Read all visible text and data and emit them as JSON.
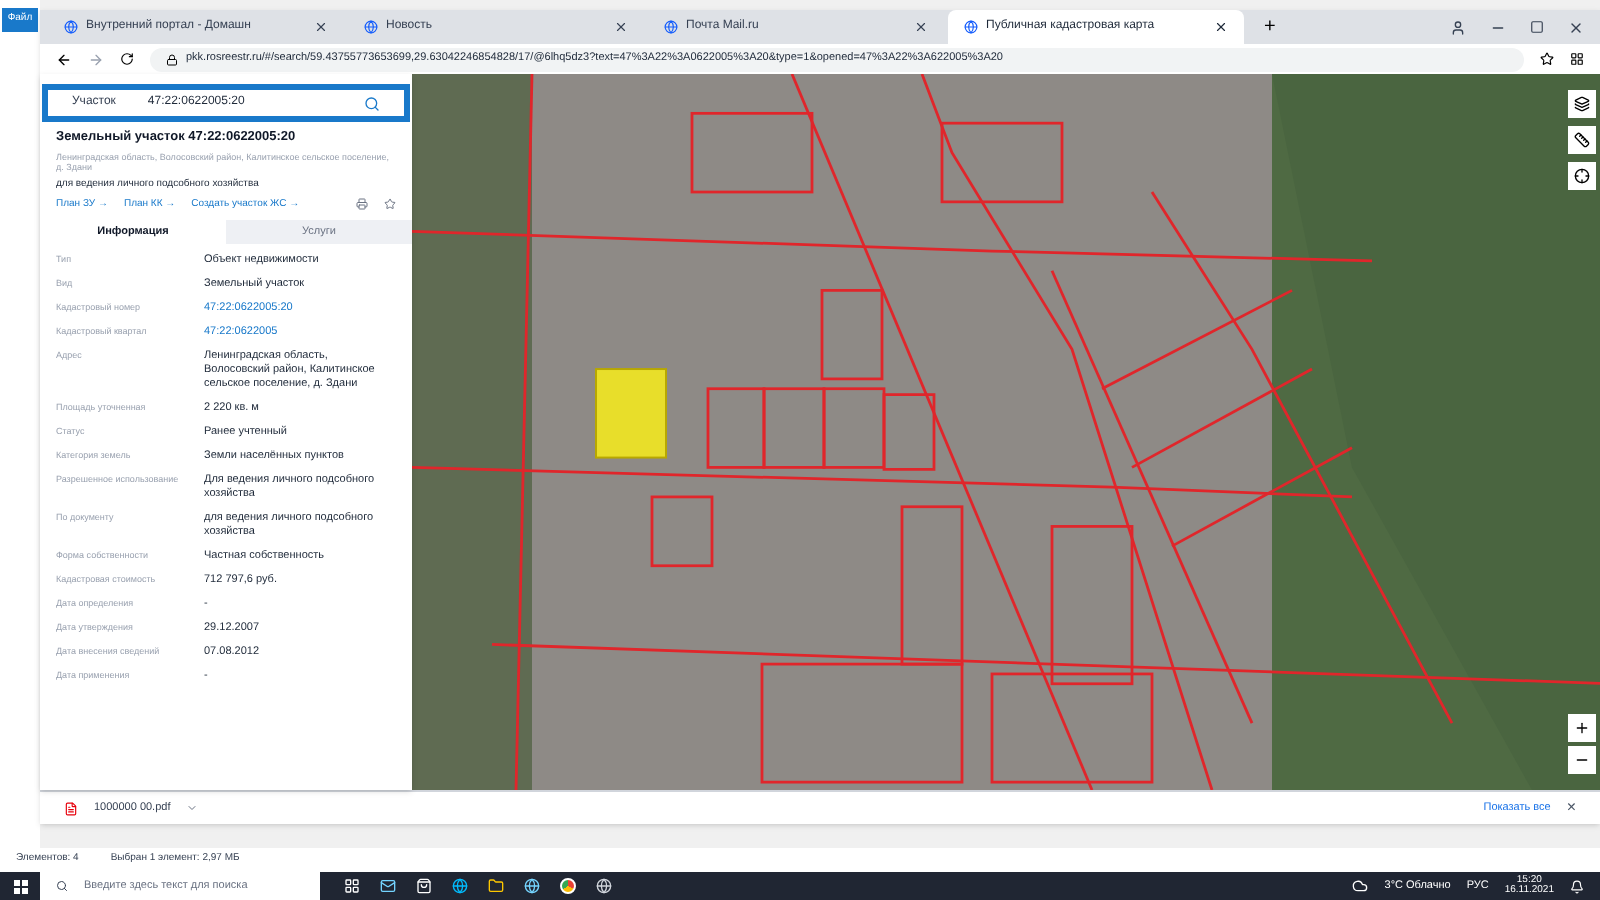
{
  "desktop": {
    "ribbon_button": "Файл"
  },
  "browser": {
    "tabs": [
      {
        "label": "Внутренний портал - Домашн",
        "selected": false
      },
      {
        "label": "Новость",
        "selected": false
      },
      {
        "label": "Почта Mail.ru",
        "selected": false
      },
      {
        "label": "Публичная кадастровая карта",
        "selected": true
      }
    ],
    "new_tab": "+",
    "url": "pkk.rosreestr.ru/#/search/59.43755773653699,29.63042246854828/17/@6lhq5dz3?text=47%3A22%3A0622005%3A20&type=1&opened=47%3A22%3A622005%3A20"
  },
  "search": {
    "type_label": "Участок",
    "value": "47:22:0622005:20"
  },
  "card": {
    "title": "Земельный участок 47:22:0622005:20",
    "address": "Ленинградская область, Волосовский район, Калитинское сельское поселение, д. Здани",
    "purpose": "для ведения личного подсобного хозяйства",
    "links": [
      "План ЗУ →",
      "План КК →",
      "Создать участок ЖС →"
    ],
    "tabs": [
      {
        "label": "Информация",
        "selected": true
      },
      {
        "label": "Услуги",
        "selected": false
      }
    ],
    "rows": [
      {
        "label": "Тип",
        "value": "Объект недвижимости",
        "kind": "text"
      },
      {
        "label": "Вид",
        "value": "Земельный участок",
        "kind": "text"
      },
      {
        "label": "Кадастровый номер",
        "value": "47:22:0622005:20",
        "kind": "link"
      },
      {
        "label": "Кадастровый квартал",
        "value": "47:22:0622005",
        "kind": "link"
      },
      {
        "label": "Адрес",
        "value": "Ленинградская область, Волосовский район, Калитинское сельское поселение, д. Здани",
        "kind": "text"
      },
      {
        "label": "Площадь уточненная",
        "value": "2 220 кв. м",
        "kind": "text"
      },
      {
        "label": "Статус",
        "value": "Ранее учтенный",
        "kind": "text"
      },
      {
        "label": "Категория земель",
        "value": "Земли населённых пунктов",
        "kind": "text"
      },
      {
        "label": "Разрешенное использование",
        "value": "Для ведения личного подсобного хозяйства",
        "kind": "text"
      },
      {
        "label": "По документу",
        "value": "для ведения личного подсобного хозяйства",
        "kind": "text"
      },
      {
        "label": "Форма собственности",
        "value": "Частная собственность",
        "kind": "text"
      },
      {
        "label": "Кадастровая стоимость",
        "value": "712 797,6 руб.",
        "kind": "text"
      },
      {
        "label": "Дата определения",
        "value": "-",
        "kind": "text"
      },
      {
        "label": "Дата утверждения",
        "value": "29.12.2007",
        "kind": "text"
      },
      {
        "label": "Дата внесения сведений",
        "value": "07.08.2012",
        "kind": "text"
      },
      {
        "label": "Дата применения",
        "value": "-",
        "kind": "text"
      }
    ]
  },
  "downloads": {
    "file": "1000000 00.pdf",
    "show_all": "Показать все",
    "close": "×"
  },
  "explorer_status": [
    "Элементов: 4",
    "Выбран 1 элемент: 2,97 МБ"
  ],
  "taskbar": {
    "search_placeholder": "Введите здесь текст для поиска",
    "weather": "3°C Облачно",
    "language": "РУС",
    "time": "15:20",
    "date": "16.11.2021"
  }
}
